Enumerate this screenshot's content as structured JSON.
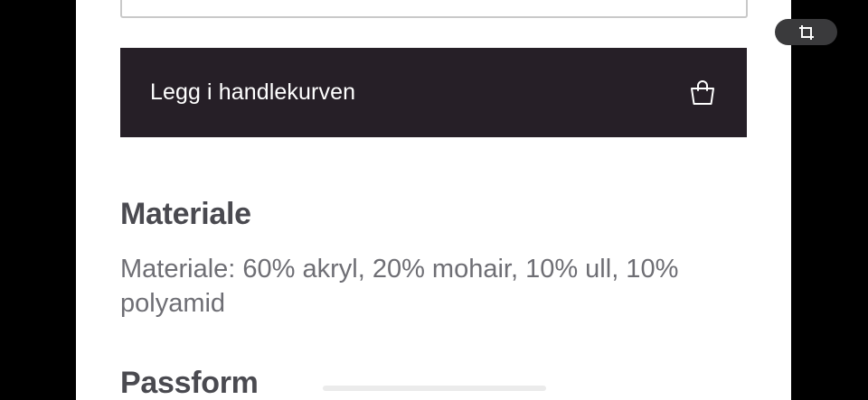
{
  "product": {
    "add_to_cart_label": "Legg i handlekurven",
    "add_to_cart_icon": "shopping-bag-icon"
  },
  "material": {
    "title": "Materiale",
    "text": "Materiale: 60% akryl, 20% mohair, 10% ull, 10% polyamid"
  },
  "fit": {
    "title": "Passform"
  },
  "overlay": {
    "crop_icon": "crop-icon"
  },
  "colors": {
    "button_background": "#261f27",
    "heading_text": "#4a4a50",
    "body_text": "#6e6e74",
    "outer_background": "#000000",
    "overlay_pill": "#3a3a3c"
  }
}
